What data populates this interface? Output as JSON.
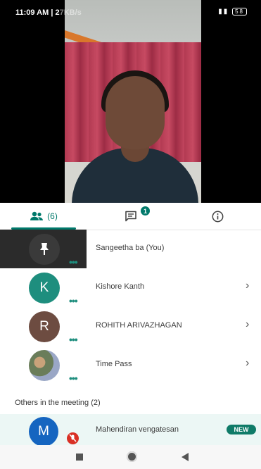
{
  "status_bar": {
    "time": "11:09 AM | 2",
    "net_speed": "7KB/s",
    "battery": "58"
  },
  "tabs": {
    "people_count": "(6)",
    "chat_badge": "1"
  },
  "participants": [
    {
      "name": "Sangeetha ba (You)",
      "avatar_letter": "",
      "avatar_color": "#3a3a3a",
      "has_chevron": false
    },
    {
      "name": "Kishore Kanth",
      "avatar_letter": "K",
      "avatar_color": "#1e8e7e",
      "has_chevron": true
    },
    {
      "name": "ROHITH ARIVAZHAGAN",
      "avatar_letter": "R",
      "avatar_color": "#6d4c41",
      "has_chevron": true
    },
    {
      "name": "Time Pass",
      "avatar_letter": "",
      "avatar_color": "#7a8a6a",
      "has_chevron": true
    }
  ],
  "dots": "•••",
  "chevron": "›",
  "others_heading": "Others in the meeting (2)",
  "other_participant": {
    "name": "Mahendiran vengatesan",
    "avatar_letter": "M",
    "avatar_color": "#1565c0",
    "badge": "NEW"
  },
  "colors": {
    "accent": "#00796b",
    "selected_row": "#000000"
  }
}
